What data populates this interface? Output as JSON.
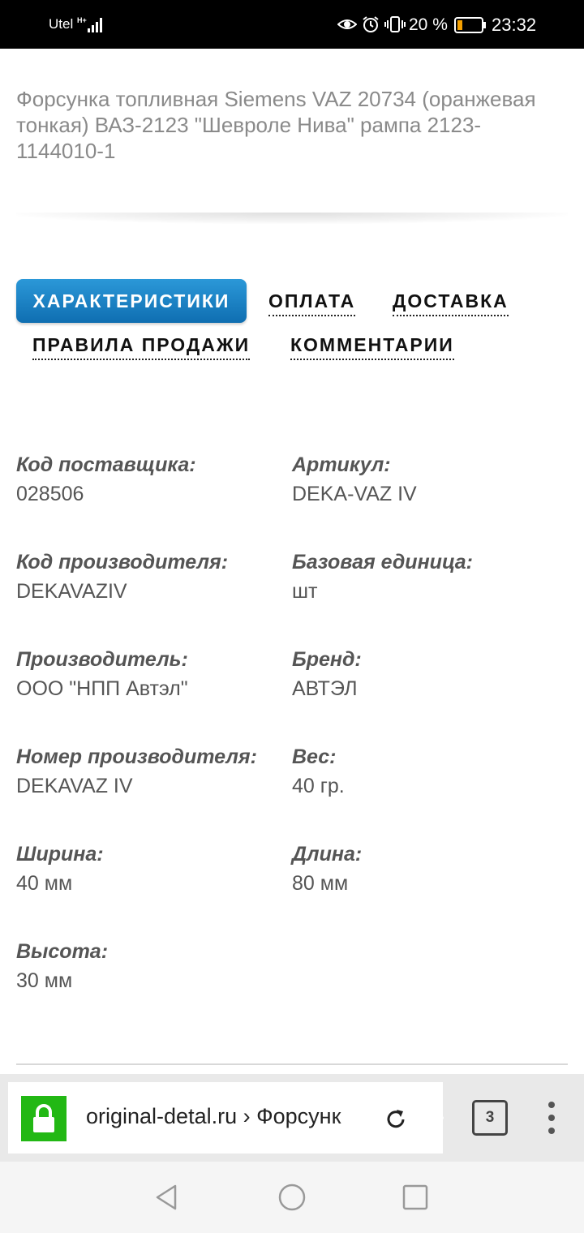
{
  "status_bar": {
    "carrier": "Utel",
    "network_type": "H+",
    "battery_percent": "20 %",
    "time": "23:32",
    "icons": [
      "signal-icon",
      "eye-icon",
      "alarm-icon",
      "vibrate-icon",
      "battery-icon"
    ]
  },
  "product": {
    "title": "Форсунка топливная Siemens VAZ 20734 (оранжевая тонкая) ВАЗ-2123 \"Шевроле Нива\" рампа 2123-1144010-1"
  },
  "tabs": {
    "active": "ХАРАКТЕРИСТИКИ",
    "payment": "ОПЛАТА",
    "delivery": "ДОСТАВКА",
    "rules": "ПРАВИЛА ПРОДАЖИ",
    "comments": "КОММЕНТАРИИ",
    "accent_color": "#1a82c6"
  },
  "specs": [
    {
      "label": "Код поставщика:",
      "value": "028506"
    },
    {
      "label": "Артикул:",
      "value": "DEKA-VAZ IV"
    },
    {
      "label": "Код производителя:",
      "value": "DEKAVAZIV"
    },
    {
      "label": "Базовая единица:",
      "value": "шт"
    },
    {
      "label": "Производитель:",
      "value": "ООО \"НПП Автэл\""
    },
    {
      "label": "Бренд:",
      "value": "АВТЭЛ"
    },
    {
      "label": "Номер производителя:",
      "value": "DEKAVAZ IV"
    },
    {
      "label": "Вес:",
      "value": "40 гр."
    },
    {
      "label": "Ширина:",
      "value": "40 мм"
    },
    {
      "label": "Длина:",
      "value": "80 мм"
    },
    {
      "label": "Высота:",
      "value": "30 мм"
    }
  ],
  "browser": {
    "url": "original-detal.ru › Форсунк",
    "tab_count": "3",
    "secure_color": "#22b814"
  }
}
